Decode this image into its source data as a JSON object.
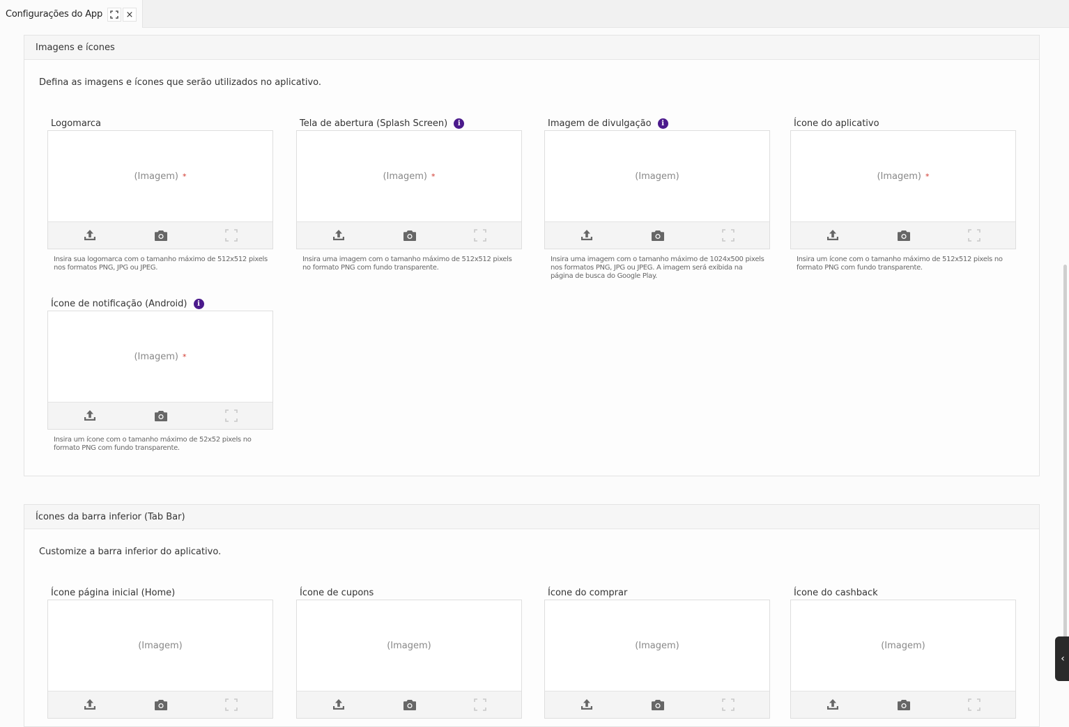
{
  "tab": {
    "title": "Configurações do App",
    "expand_icon": "expand-icon",
    "close_label": "×"
  },
  "sections": [
    {
      "title": "Imagens e ícones",
      "description": "Defina as imagens e ícones que serão utilizados no aplicativo.",
      "fields": [
        {
          "label": "Logomarca",
          "info": false,
          "placeholder": "(Imagem)",
          "required": "*",
          "hint": "Insira sua logomarca com o tamanho máximo de 512x512 pixels nos formatos PNG, JPG ou JPEG."
        },
        {
          "label": "Tela de abertura (Splash Screen)",
          "info": true,
          "placeholder": "(Imagem)",
          "required": "*",
          "hint": "Insira uma imagem com o tamanho máximo de 512x512 pixels no formato PNG com fundo transparente."
        },
        {
          "label": "Imagem de divulgação",
          "info": true,
          "placeholder": "(Imagem)",
          "required": "",
          "hint": "Insira uma imagem com o tamanho máximo de 1024x500 pixels nos formatos PNG, JPG ou JPEG. A imagem será exibida na página de busca do Google Play."
        },
        {
          "label": "Ícone do aplicativo",
          "info": false,
          "placeholder": "(Imagem)",
          "required": "*",
          "hint": "Insira um ícone com o tamanho máximo de 512x512 pixels no formato PNG com fundo transparente."
        },
        {
          "label": "Ícone de notificação (Android)",
          "info": true,
          "placeholder": "(Imagem)",
          "required": "*",
          "hint": "Insira um ícone com o tamanho máximo de 52x52 pixels no formato PNG com fundo transparente."
        }
      ]
    },
    {
      "title": "Ícones da barra inferior (Tab Bar)",
      "description": "Customize a barra inferior do aplicativo.",
      "fields": [
        {
          "label": "Ícone página inicial (Home)",
          "info": false,
          "placeholder": "(Imagem)",
          "required": "",
          "hint": ""
        },
        {
          "label": "Ícone de cupons",
          "info": false,
          "placeholder": "(Imagem)",
          "required": "",
          "hint": ""
        },
        {
          "label": "Ícone do comprar",
          "info": false,
          "placeholder": "(Imagem)",
          "required": "",
          "hint": ""
        },
        {
          "label": "Ícone do cashback",
          "info": false,
          "placeholder": "(Imagem)",
          "required": "",
          "hint": ""
        }
      ]
    }
  ],
  "info_icon_glyph": "i",
  "side_handle_glyph": "‹",
  "colors": {
    "accent": "#4b1a8c",
    "required": "#d0352b"
  }
}
